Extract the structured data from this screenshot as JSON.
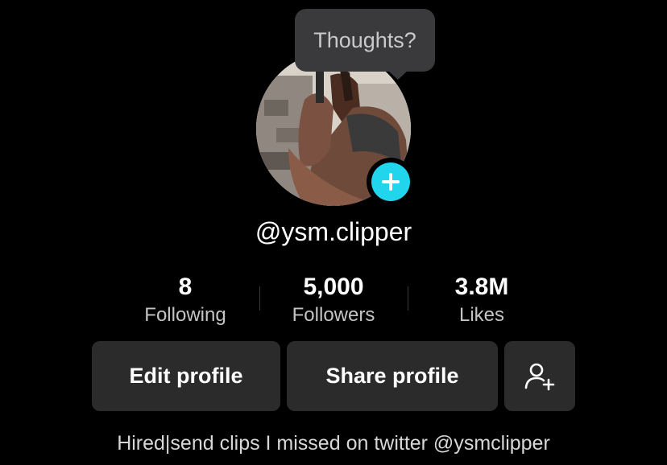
{
  "tooltip": {
    "text": "Thoughts?"
  },
  "profile": {
    "username": "@ysm.clipper",
    "bio": "Hired|send clips I missed on twitter @ysmclipper"
  },
  "stats": [
    {
      "value": "8",
      "label": "Following"
    },
    {
      "value": "5,000",
      "label": "Followers"
    },
    {
      "value": "3.8M",
      "label": "Likes"
    }
  ],
  "actions": {
    "edit_profile": "Edit profile",
    "share_profile": "Share profile",
    "add_friends_icon": "person-plus-icon"
  },
  "colors": {
    "background": "#000000",
    "button_bg": "#2b2b2b",
    "accent_add": "#20d5ec",
    "tooltip_bg": "#3a3a3c"
  }
}
